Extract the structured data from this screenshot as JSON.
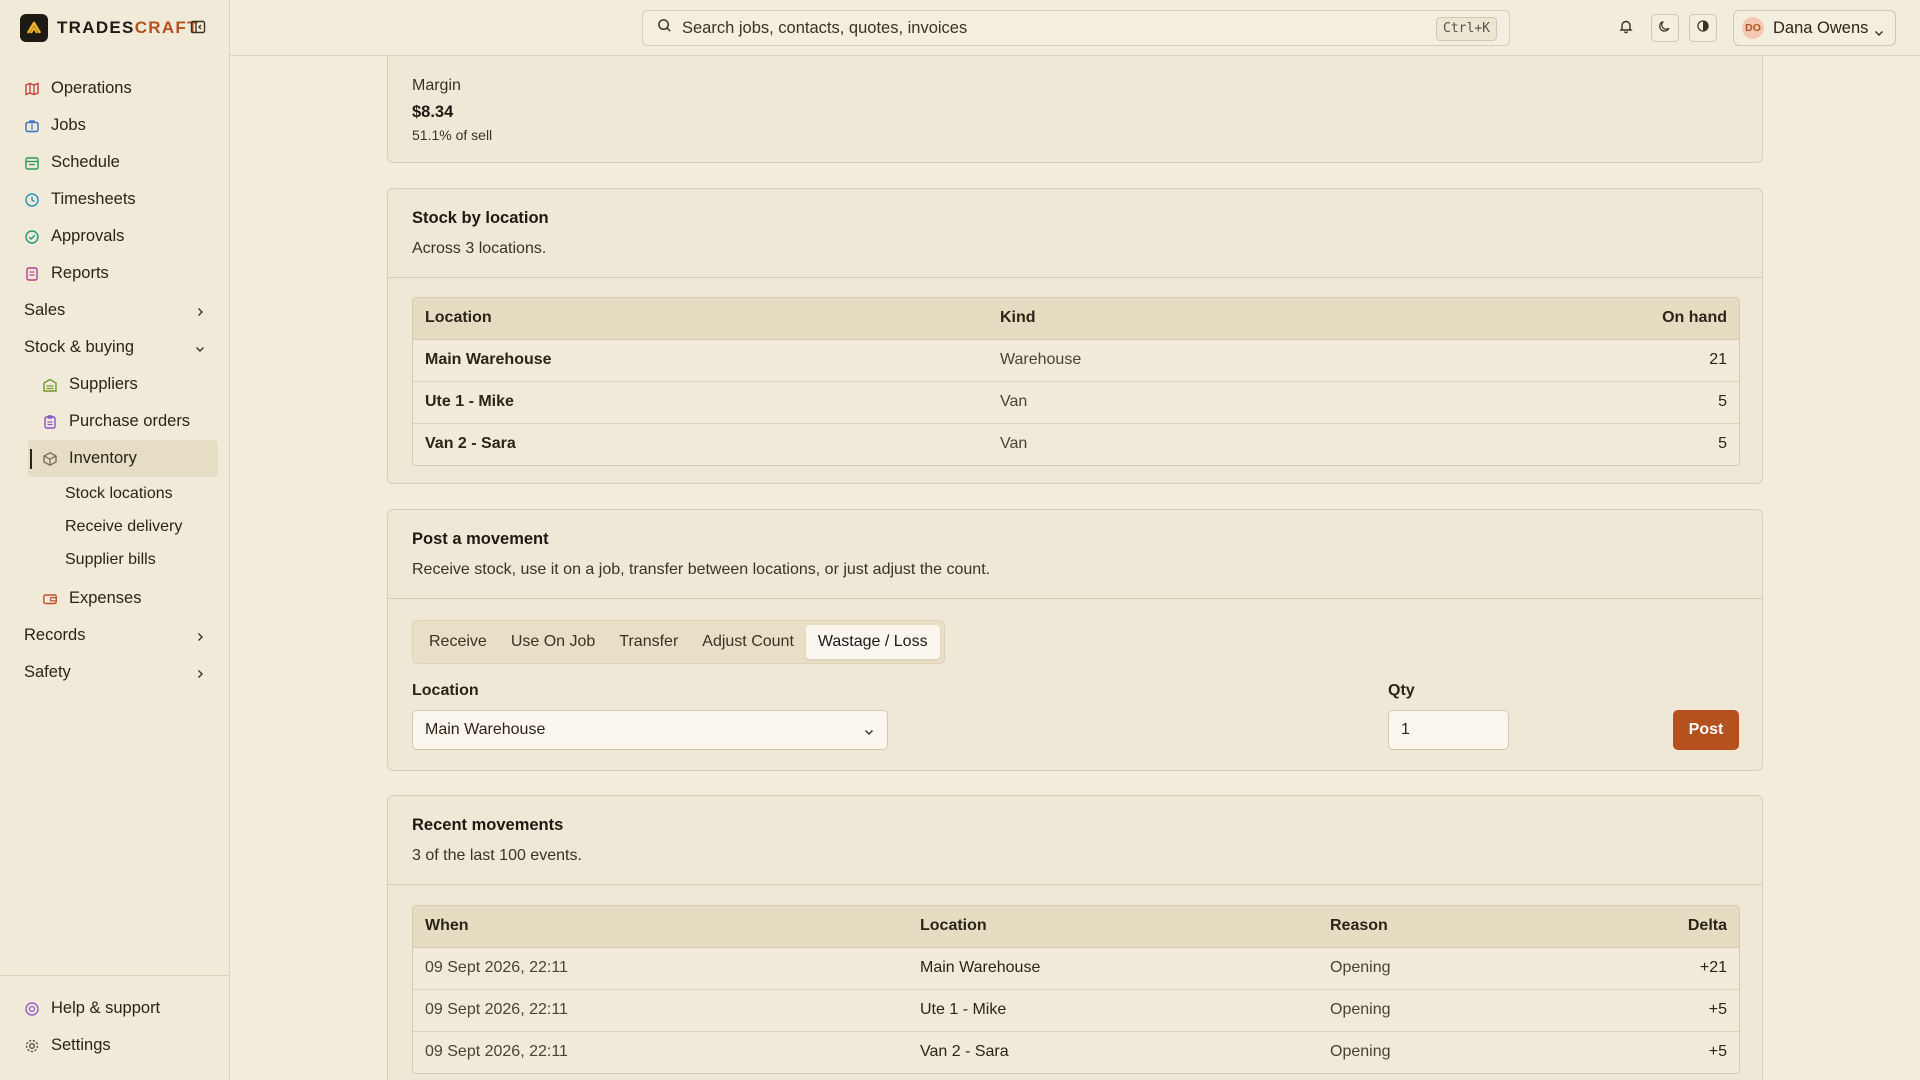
{
  "brand": {
    "name_main": "TRADES",
    "name_accent": "CRAFT"
  },
  "nav": {
    "items": [
      {
        "label": "Operations"
      },
      {
        "label": "Jobs"
      },
      {
        "label": "Schedule"
      },
      {
        "label": "Timesheets"
      },
      {
        "label": "Approvals"
      },
      {
        "label": "Reports"
      }
    ],
    "sales": "Sales",
    "stock_buying": "Stock & buying",
    "stock_sub": [
      {
        "label": "Suppliers"
      },
      {
        "label": "Purchase orders"
      },
      {
        "label": "Inventory"
      }
    ],
    "inventory_sub": [
      "Stock locations",
      "Receive delivery",
      "Supplier bills"
    ],
    "expenses": "Expenses",
    "records": "Records",
    "safety": "Safety",
    "help": "Help & support",
    "settings": "Settings"
  },
  "topbar": {
    "search_placeholder": "Search jobs, contacts, quotes, invoices",
    "shortcut": "Ctrl+K",
    "user_initials": "DO",
    "user_name": "Dana Owens"
  },
  "margin": {
    "label": "Margin",
    "value": "$8.34",
    "pct": "51.1% of sell"
  },
  "stock_by_location": {
    "title": "Stock by location",
    "subtitle": "Across 3 locations.",
    "headers": [
      "Location",
      "Kind",
      "On hand"
    ],
    "rows": [
      {
        "location": "Main Warehouse",
        "kind": "Warehouse",
        "on_hand": "21"
      },
      {
        "location": "Ute 1 - Mike",
        "kind": "Van",
        "on_hand": "5"
      },
      {
        "location": "Van 2 - Sara",
        "kind": "Van",
        "on_hand": "5"
      }
    ]
  },
  "post_movement": {
    "title": "Post a movement",
    "subtitle": "Receive stock, use it on a job, transfer between locations, or just adjust the count.",
    "tabs": [
      "Receive",
      "Use On Job",
      "Transfer",
      "Adjust Count",
      "Wastage / Loss"
    ],
    "active_tab": "Wastage / Loss",
    "location_label": "Location",
    "location_value": "Main Warehouse",
    "qty_label": "Qty",
    "qty_value": "1",
    "post_label": "Post"
  },
  "recent_movements": {
    "title": "Recent movements",
    "subtitle": "3 of the last 100 events.",
    "headers": [
      "When",
      "Location",
      "Reason",
      "Delta"
    ],
    "rows": [
      {
        "when": "09 Sept 2026, 22:11",
        "location": "Main Warehouse",
        "reason": "Opening",
        "delta": "+21"
      },
      {
        "when": "09 Sept 2026, 22:11",
        "location": "Ute 1 - Mike",
        "reason": "Opening",
        "delta": "+5"
      },
      {
        "when": "09 Sept 2026, 22:11",
        "location": "Van 2 - Sara",
        "reason": "Opening",
        "delta": "+5"
      }
    ]
  }
}
